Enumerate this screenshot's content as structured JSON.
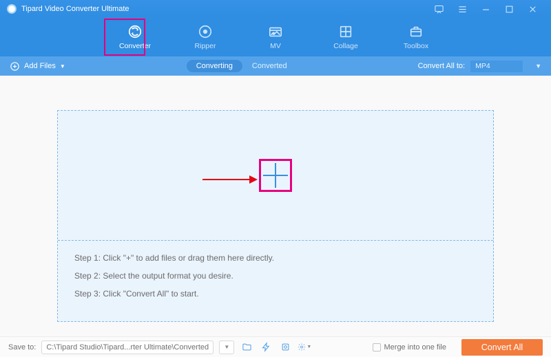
{
  "titlebar": {
    "title": "Tipard Video Converter Ultimate"
  },
  "nav": {
    "converter": "Converter",
    "ripper": "Ripper",
    "mv": "MV",
    "collage": "Collage",
    "toolbox": "Toolbox"
  },
  "subbar": {
    "add_files": "Add Files",
    "tab_converting": "Converting",
    "tab_converted": "Converted",
    "convert_all_to": "Convert All to:",
    "format": "MP4"
  },
  "steps": {
    "s1": "Step 1: Click \"+\" to add files or drag them here directly.",
    "s2": "Step 2: Select the output format you desire.",
    "s3": "Step 3: Click \"Convert All\" to start."
  },
  "bottom": {
    "save_to": "Save to:",
    "path": "C:\\Tipard Studio\\Tipard...rter Ultimate\\Converted",
    "merge": "Merge into one file",
    "convert_all": "Convert All"
  }
}
